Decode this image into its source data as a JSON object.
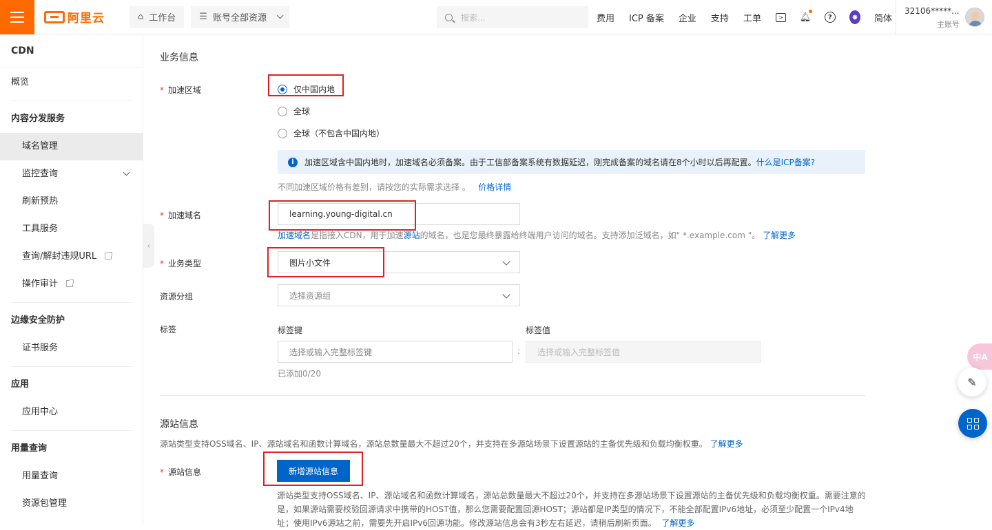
{
  "topbar": {
    "logo_text": "阿里云",
    "workbench": "工作台",
    "resources": "账号全部资源",
    "search_placeholder": "搜索...",
    "nav": [
      "费用",
      "ICP 备案",
      "企业",
      "支持",
      "工单"
    ],
    "lang": "简体",
    "account_id": "32106*****...",
    "account_role": "主账号"
  },
  "sidebar": {
    "title": "CDN",
    "overview": "概览",
    "group1": "内容分发服务",
    "domain_mgmt": "域名管理",
    "monitor": "监控查询",
    "refresh": "刷新预热",
    "tools": "工具服务",
    "query_url": "查询/解封违规URL",
    "audit": "操作审计",
    "group2": "边缘安全防护",
    "cert": "证书服务",
    "group3": "应用",
    "app_center": "应用中心",
    "group4": "用量查询",
    "usage": "用量查询",
    "package": "资源包管理"
  },
  "form": {
    "business_title": "业务信息",
    "region_label": "加速区域",
    "region_options": [
      "仅中国内地",
      "全球",
      "全球（不包含中国内地）"
    ],
    "notice_text": "加速区域含中国内地时，加速域名必须备案。由于工信部备案系统有数据延迟，刚完成备案的域名请在8个小时以后再配置。",
    "notice_link": "什么是ICP备案?",
    "price_hint": "不同加速区域价格有差别，请按您的实际需求选择 。",
    "price_link": "价格详情",
    "domain_label": "加速域名",
    "domain_value": "learning.young-digital.cn",
    "domain_hint_link1": "加速域名",
    "domain_hint_a": "是指接入CDN，用于加速",
    "domain_hint_link2": "源站",
    "domain_hint_b": "的域名，也是您最终暴露给终端用户访问的域名。支持添加泛域名，如\" *.example.com \"。",
    "domain_hint_link3": "了解更多",
    "biz_type_label": "业务类型",
    "biz_type_value": "图片小文件",
    "resgroup_label": "资源分组",
    "resgroup_placeholder": "选择资源组",
    "tag_label": "标签",
    "tag_key_header": "标签键",
    "tag_value_header": "标签值",
    "tag_key_placeholder": "选择或输入完整标签键",
    "tag_value_placeholder": "选择或输入完整标签值",
    "tag_count": "已添加0/20",
    "origin_title": "源站信息",
    "origin_desc": "源站类型支持OSS域名、IP、源站域名和函数计算域名，源站总数量最大不超过20个，并支持在多源站场景下设置源站的主备优先级和负载均衡权重。",
    "origin_desc_link": "了解更多",
    "origin_label": "源站信息",
    "add_origin_button": "新增源站信息",
    "origin_long_desc": "源站类型支持OSS域名、IP、源站域名和函数计算域名，源站总数量最大不超过20个，并支持在多源站场景下设置源站的主备优先级和负载均衡权重。需要注意的是，如果源站需要校验回源请求中携带的HOST值，那么您需要配置回源HOST；源站都是IP类型的情况下，不能全部配置IPv6地址，必须至少配置一个IPv4地址；使用IPv6源站之前，需要先开启IPv6回源功能。修改源站信息会有3秒左右延迟，请稍后刷新页面。",
    "origin_long_link": "了解更多"
  },
  "colors": {
    "brand": "#ff6a00",
    "primary": "#0064c8",
    "highlight": "#e02020"
  }
}
